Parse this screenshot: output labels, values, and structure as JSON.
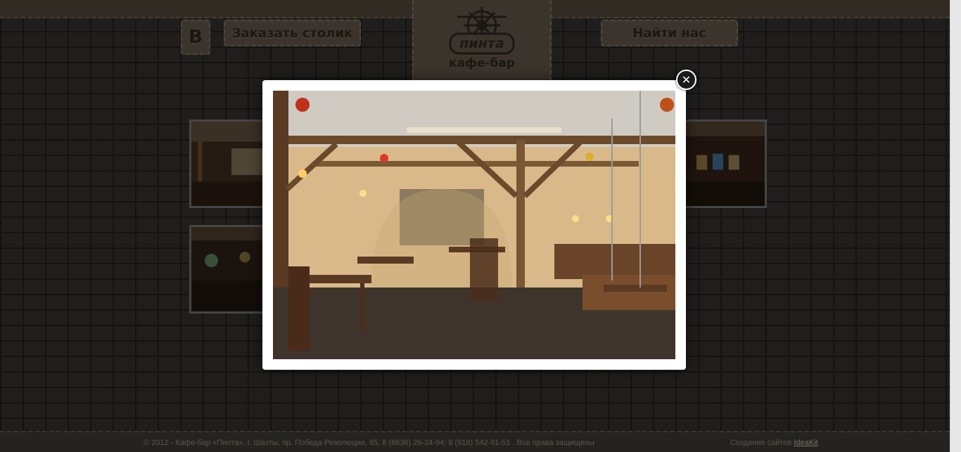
{
  "header": {
    "vk_label": "В",
    "reserve_label": "Заказать столик",
    "find_label": "Найти нас",
    "logo_name": "пинта",
    "logo_subtitle": "кафе-бар"
  },
  "gallery": {
    "thumbnails": [
      {
        "icon": "restaurant-interior-photo"
      },
      {
        "icon": "restaurant-interior-photo"
      },
      {
        "icon": "restaurant-interior-photo"
      }
    ]
  },
  "lightbox": {
    "close_label": "✕",
    "photo": "restaurant-interior-photo"
  },
  "footer": {
    "copyright": "© 2012 - Кафе-бар «Пинта». г. Шахты, пр. Победа Революции, 85, 8 (8636) 26-24-94; 8 (918) 542-91-51 . Все права защищены",
    "credit_prefix": "Создание сайтов",
    "credit_link": "IdeaKit"
  },
  "colors": {
    "panel": "#5b5144",
    "brick": "#302f2d",
    "overlay": "rgba(0,0,0,0.35)"
  }
}
